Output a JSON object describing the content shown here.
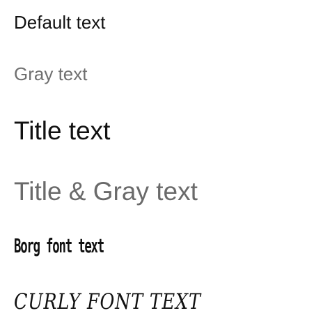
{
  "samples": {
    "default_text": "Default text",
    "gray_text": "Gray text",
    "title_text": "Title text",
    "title_gray_text": "Title & Gray text",
    "borg_font_text": "Borg font text",
    "curly_font_text": "CURLY FONT TEXT"
  },
  "colors": {
    "default": "#111111",
    "gray": "#6f6f6f",
    "background": "#ffffff"
  }
}
